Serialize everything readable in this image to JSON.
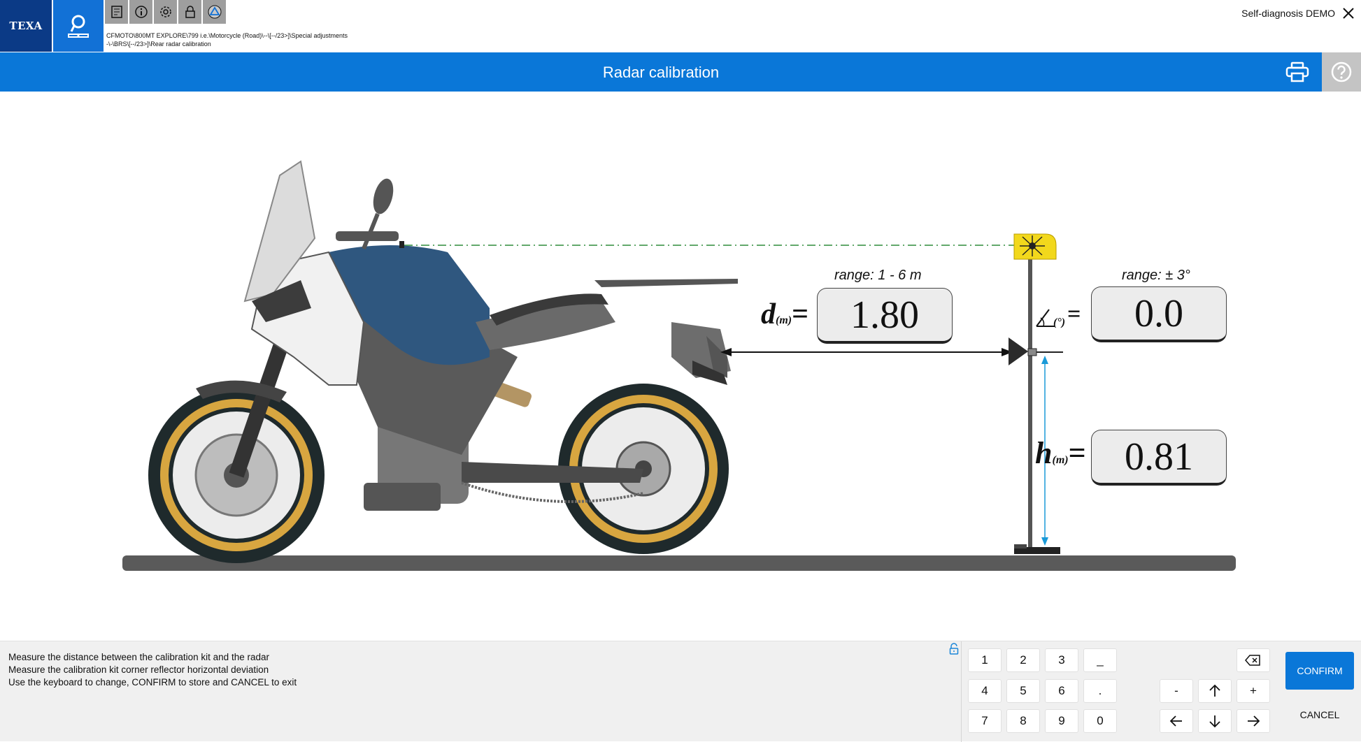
{
  "header": {
    "brand": "TEXA",
    "breadcrumb_line1": "CFMOTO\\800MT EXPLORE\\799 i.e.\\Motorcycle (Road)\\--\\[--/23>]\\Special adjustments",
    "breadcrumb_line2": "-\\-\\BRS\\[--/23>]\\Rear radar calibration",
    "session_label": "Self-diagnosis DEMO",
    "toolbar_icons": [
      "report-icon",
      "info-icon",
      "settings-icon",
      "ecu-lock-icon",
      "triangle-icon"
    ]
  },
  "title_bar": {
    "title": "Radar calibration"
  },
  "calibration": {
    "distance": {
      "symbol": "d",
      "unit": "(m)",
      "range": "range: 1 - 6 m",
      "value": "1.80"
    },
    "angle": {
      "unit": "(°)",
      "range": "range: ± 3°",
      "value": "0.0"
    },
    "height": {
      "symbol": "h",
      "unit": "(m)",
      "value": "0.81"
    }
  },
  "instructions": [
    "Measure the distance between the calibration kit and the radar",
    "Measure the calibration kit corner reflector horizontal deviation",
    "Use the keyboard to change, CONFIRM to store and CANCEL to exit"
  ],
  "keypad": {
    "row1": [
      "1",
      "2",
      "3",
      "_"
    ],
    "row2": [
      "4",
      "5",
      "6",
      "."
    ],
    "row3": [
      "7",
      "8",
      "9",
      "0"
    ]
  },
  "nav_keys": {
    "minus": "-",
    "plus": "+"
  },
  "actions": {
    "confirm": "CONFIRM",
    "cancel": "CANCEL"
  },
  "colors": {
    "brand_dark": "#0b3a86",
    "accent_blue": "#0a77d8",
    "laser_yellow": "#f2d81c"
  }
}
